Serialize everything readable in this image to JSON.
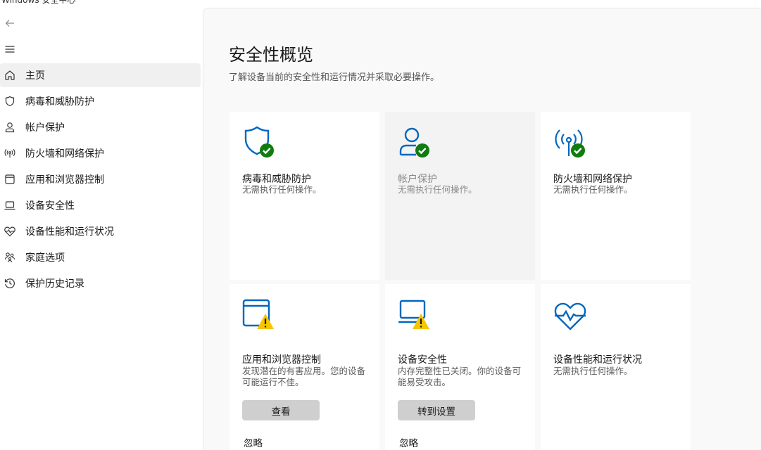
{
  "window": {
    "title": "Windows 安全中心"
  },
  "sidebar": {
    "items": [
      {
        "label": "主页",
        "icon": "home-icon"
      },
      {
        "label": "病毒和威胁防护",
        "icon": "shield-icon"
      },
      {
        "label": "帐户保护",
        "icon": "person-icon"
      },
      {
        "label": "防火墙和网络保护",
        "icon": "antenna-icon"
      },
      {
        "label": "应用和浏览器控制",
        "icon": "app-window-icon"
      },
      {
        "label": "设备安全性",
        "icon": "laptop-icon"
      },
      {
        "label": "设备性能和运行状况",
        "icon": "heart-pulse-icon"
      },
      {
        "label": "家庭选项",
        "icon": "family-icon"
      },
      {
        "label": "保护历史记录",
        "icon": "history-icon"
      }
    ]
  },
  "main": {
    "title": "安全性概览",
    "subtitle": "了解设备当前的安全性和运行情况并采取必要操作。",
    "tiles": [
      {
        "title": "病毒和威胁防护",
        "desc": "无需执行任何操作。",
        "status": "ok"
      },
      {
        "title": "帐户保护",
        "desc": "无需执行任何操作。",
        "status": "ok"
      },
      {
        "title": "防火墙和网络保护",
        "desc": "无需执行任何操作。",
        "status": "ok"
      },
      {
        "title": "应用和浏览器控制",
        "desc": "发现潜在的有害应用。您的设备可能运行不佳。",
        "status": "warning",
        "button": "查看",
        "dismiss": "忽略"
      },
      {
        "title": "设备安全性",
        "desc": "内存完整性已关闭。你的设备可能易受攻击。",
        "status": "warning",
        "button": "转到设置",
        "dismiss": "忽略"
      },
      {
        "title": "设备性能和运行状况",
        "desc": "无需执行任何操作。",
        "status": "ok"
      }
    ]
  },
  "colors": {
    "accent": "#0067c0",
    "ok": "#107c10",
    "warning": "#f7c600"
  }
}
